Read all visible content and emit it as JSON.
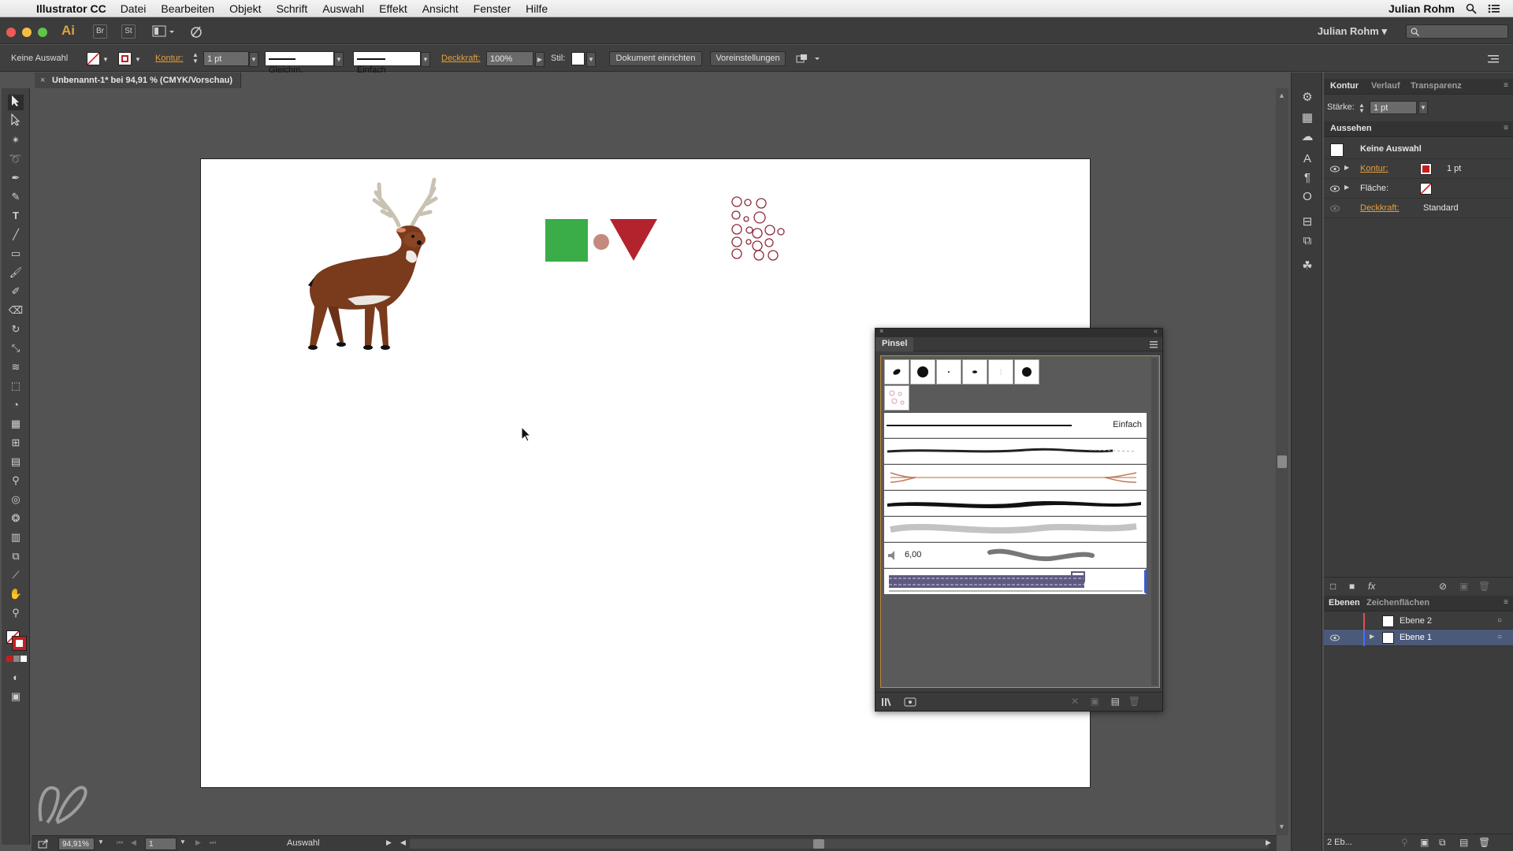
{
  "menubar": {
    "app": "Illustrator CC",
    "items": [
      "Datei",
      "Bearbeiten",
      "Objekt",
      "Schrift",
      "Auswahl",
      "Effekt",
      "Ansicht",
      "Fenster",
      "Hilfe"
    ],
    "user": "Julian Rohm"
  },
  "appbar": {
    "logo": "Ai",
    "bridge": "Br",
    "stock": "St",
    "workspace": "Julian Rohm",
    "workspace_arrow": "▾"
  },
  "control": {
    "selection": "Keine Auswahl",
    "kontur_label": "Kontur:",
    "stroke_weight": "1 pt",
    "profile": "Gleichm.",
    "brush": "Einfach",
    "opacity_label": "Deckkraft:",
    "opacity": "100%",
    "style_label": "Stil:",
    "document_setup": "Dokument einrichten",
    "preferences": "Voreinstellungen"
  },
  "document": {
    "tab_title": "Unbenannt-1* bei 94,91 % (CMYK/Vorschau)"
  },
  "statusbar": {
    "zoom": "94,91%",
    "artboard": "1",
    "mode": "Auswahl"
  },
  "panels": {
    "stroke_tabs": [
      "Kontur",
      "Verlauf",
      "Transparenz"
    ],
    "staerke_label": "Stärke:",
    "staerke_value": "1 pt",
    "appearance_title": "Aussehen",
    "appearance_selection": "Keine Auswahl",
    "appearance_kontur": "Kontur:",
    "appearance_kontur_value": "1 pt",
    "appearance_flaeche": "Fläche:",
    "appearance_deckkraft": "Deckkraft:",
    "appearance_deckkraft_value": "Standard",
    "layers_tabs": [
      "Ebenen",
      "Zeichenflächen"
    ],
    "layers": [
      {
        "name": "Ebene 2",
        "color": "#e05050"
      },
      {
        "name": "Ebene 1",
        "color": "#4a6cff"
      }
    ],
    "layers_count": "2 Eb..."
  },
  "brush_panel": {
    "title": "Pinsel",
    "basic_brush": "Einfach",
    "bristle_value": "6,00"
  },
  "colors": {
    "accent": "#e3a03b",
    "deer_brown": "#7a3a1c",
    "green_square": "#3aac48",
    "red_triangle": "#b2232e",
    "dot": "#c48a7d",
    "circles": "#8c2b3a"
  }
}
